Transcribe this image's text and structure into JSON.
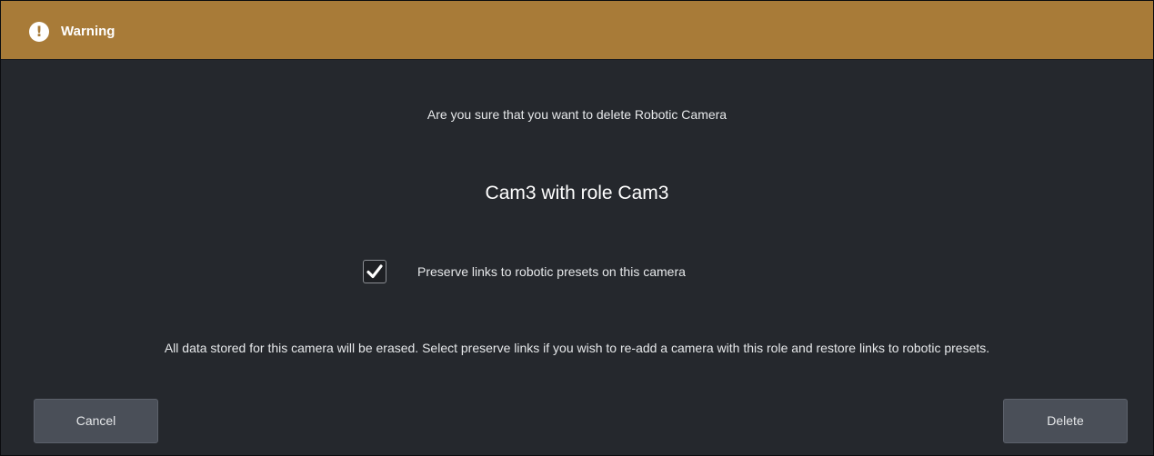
{
  "dialog": {
    "title": "Warning",
    "icon": "exclamation-icon",
    "accent_color": "#a87b38",
    "background_color": "#25282d",
    "question": "Are you sure that you want to delete Robotic Camera",
    "subject": "Cam3 with role Cam3",
    "preserve_checkbox": {
      "label": "Preserve links to robotic presets on this camera",
      "checked": true
    },
    "note": "All data stored for this camera will be erased. Select preserve links if you wish to re-add a camera with this role and restore links to robotic presets.",
    "buttons": {
      "cancel_label": "Cancel",
      "delete_label": "Delete"
    }
  }
}
